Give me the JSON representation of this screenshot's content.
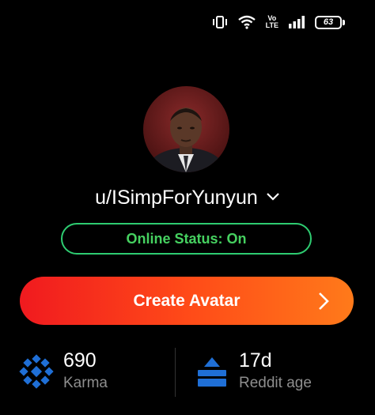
{
  "status_bar": {
    "icons": [
      "vibrate-icon",
      "wifi-icon",
      "volte-icon",
      "signal-icon"
    ],
    "volte_text_top": "Vo",
    "volte_text_bottom": "LTE",
    "battery_level": "63"
  },
  "profile": {
    "username": "u/ISimpForYunyun",
    "online_status": "Online Status: On"
  },
  "actions": {
    "create_avatar_label": "Create Avatar"
  },
  "stats": {
    "karma_value": "690",
    "karma_label": "Karma",
    "age_value": "17d",
    "age_label": "Reddit age"
  },
  "colors": {
    "online_green": "#46d160",
    "button_gradient_start": "#f01a1f",
    "button_gradient_end": "#ff7a1a",
    "stat_icon_blue": "#1f6fd6"
  }
}
